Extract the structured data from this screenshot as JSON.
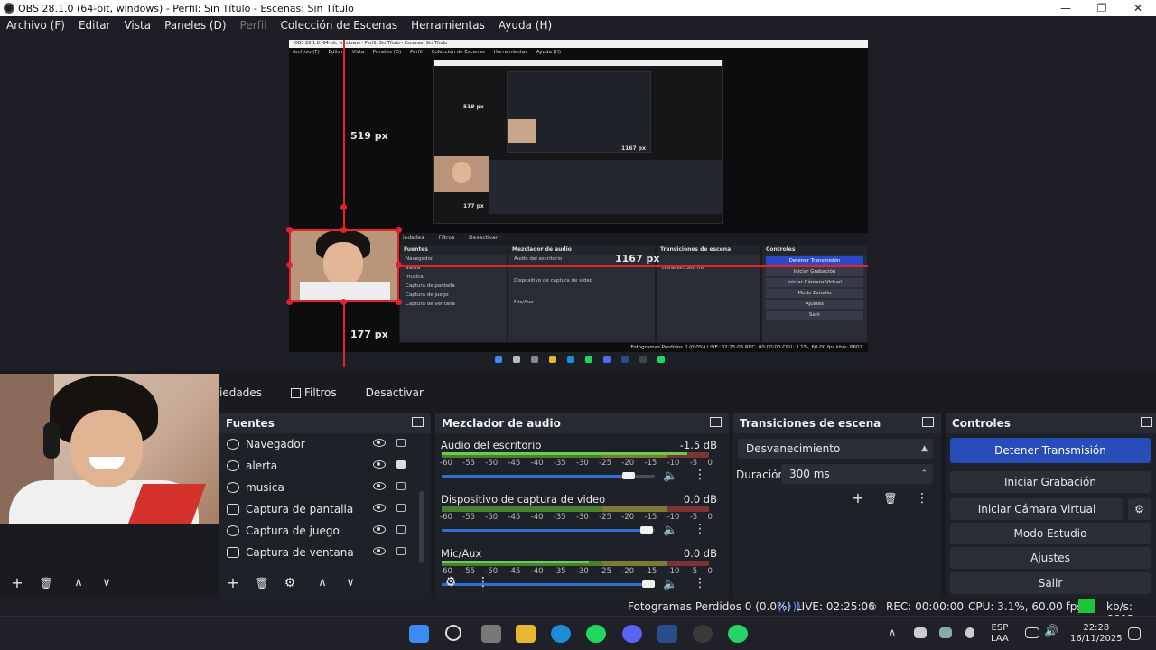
{
  "window": {
    "title": "OBS 28.1.0 (64-bit, windows) - Perfil: Sin Título - Escenas: Sin Título",
    "controls": [
      "—",
      "❐",
      "✕"
    ]
  },
  "menu": {
    "items": [
      "Archivo (F)",
      "Editar",
      "Vista",
      "Paneles (D)",
      "Perfil",
      "Colección de Escenas",
      "Herramientas",
      "Ayuda (H)"
    ]
  },
  "preview": {
    "inner_title": "OBS 28.1.0 (64-bit, windows) - Perfil: Sin Título - Escenas: Sin Título",
    "inner_menu": [
      "Archivo (F)",
      "Editar",
      "Vista",
      "Paneles (D)",
      "Perfil",
      "Colección de Escenas",
      "Herramientas",
      "Ayuda (H)"
    ],
    "measure_top": "519 px",
    "measure_top_inner": "519 px",
    "measure_right": "1167 px",
    "measure_right_inner": "1167 px",
    "measure_bottom": "177 px",
    "measure_bottom_inner": "177 px",
    "inner_tabs": [
      "iedades",
      "Filtros",
      "Desactivar"
    ],
    "inner_docks": {
      "fuentes": "Fuentes",
      "mezclador": "Mezclador de audio",
      "transiciones": "Transiciones de escena",
      "controles": "Controles",
      "sources": [
        "Navegador",
        "alerta",
        "musica",
        "Captura de pantalla",
        "Captura de juego",
        "Captura de ventana"
      ],
      "mixer": [
        "Audio del escritorio",
        "Dispositivo de captura de video",
        "Mic/Aux"
      ],
      "transition": "Duración",
      "transition_value": "300 ms",
      "controls": [
        "Detener Transmisión",
        "Iniciar Grabación",
        "Iniciar Cámara Virtual",
        "Modo Estudio",
        "Ajustes",
        "Salir"
      ],
      "status": "Fotogramas Perdidos 0 (0.0%)   LIVE: 02:25:06   REC: 00:00:00   CPU: 3.1%, 60.00 fps   kb/s: 6602"
    }
  },
  "tabs": {
    "props": "iedades",
    "filters": "Filtros",
    "deactivate": "Desactivar"
  },
  "sources": {
    "title": "Fuentes",
    "items": [
      {
        "label": "Navegador",
        "icon": "browser-icon",
        "locked": false
      },
      {
        "label": "alerta",
        "icon": "browser-icon",
        "locked": true
      },
      {
        "label": "musica",
        "icon": "browser-icon",
        "locked": false
      },
      {
        "label": "Captura de pantalla",
        "icon": "monitor-icon",
        "locked": false
      },
      {
        "label": "Captura de juego",
        "icon": "gamepad-icon",
        "locked": false
      },
      {
        "label": "Captura de ventana",
        "icon": "window-icon",
        "locked": false
      }
    ],
    "toolbar": [
      "+",
      "🗑",
      "⚙",
      "∧",
      "∨"
    ]
  },
  "scenes_toolbar": [
    "+",
    "🗑",
    "∧",
    "∨"
  ],
  "mixer": {
    "title": "Mezclador de audio",
    "ticks": [
      "-60",
      "-55",
      "-50",
      "-45",
      "-40",
      "-35",
      "-30",
      "-25",
      "-20",
      "-15",
      "-10",
      "-5",
      "0"
    ],
    "channels": [
      {
        "name": "Audio del escritorio",
        "db": "-1.5 dB",
        "level": 0.92,
        "volume": 0.9,
        "muted": false
      },
      {
        "name": "Dispositivo de captura de video",
        "db": "0.0 dB",
        "level": 0.0,
        "volume": 0.99,
        "muted": true
      },
      {
        "name": "Mic/Aux",
        "db": "0.0 dB",
        "level": 0.55,
        "volume": 1.0,
        "muted": false
      }
    ]
  },
  "transitions": {
    "title": "Transiciones de escena",
    "selected": "Desvanecimiento",
    "duration_label": "Duración",
    "duration_value": "300 ms"
  },
  "controls": {
    "title": "Controles",
    "stop_stream": "Detener Transmisión",
    "start_recording": "Iniciar Grabación",
    "start_virtualcam": "Iniciar Cámara Virtual",
    "studio_mode": "Modo Estudio",
    "settings": "Ajustes",
    "exit": "Salir"
  },
  "status": {
    "dropped": "Fotogramas Perdidos 0 (0.0%)",
    "live": "LIVE: 02:25:06",
    "rec": "REC: 00:00:00",
    "cpu": "CPU: 3.1%, 60.00 fps",
    "kbps": "kb/s: 6602"
  },
  "taskbar": {
    "lang": "ESP",
    "lang2": "LAA",
    "time": "22:28",
    "date": "16/11/2025"
  },
  "colors": {
    "accent_blue": "#284cb8",
    "selection_red": "#e5212b",
    "stream_green": "#1ec43c"
  }
}
